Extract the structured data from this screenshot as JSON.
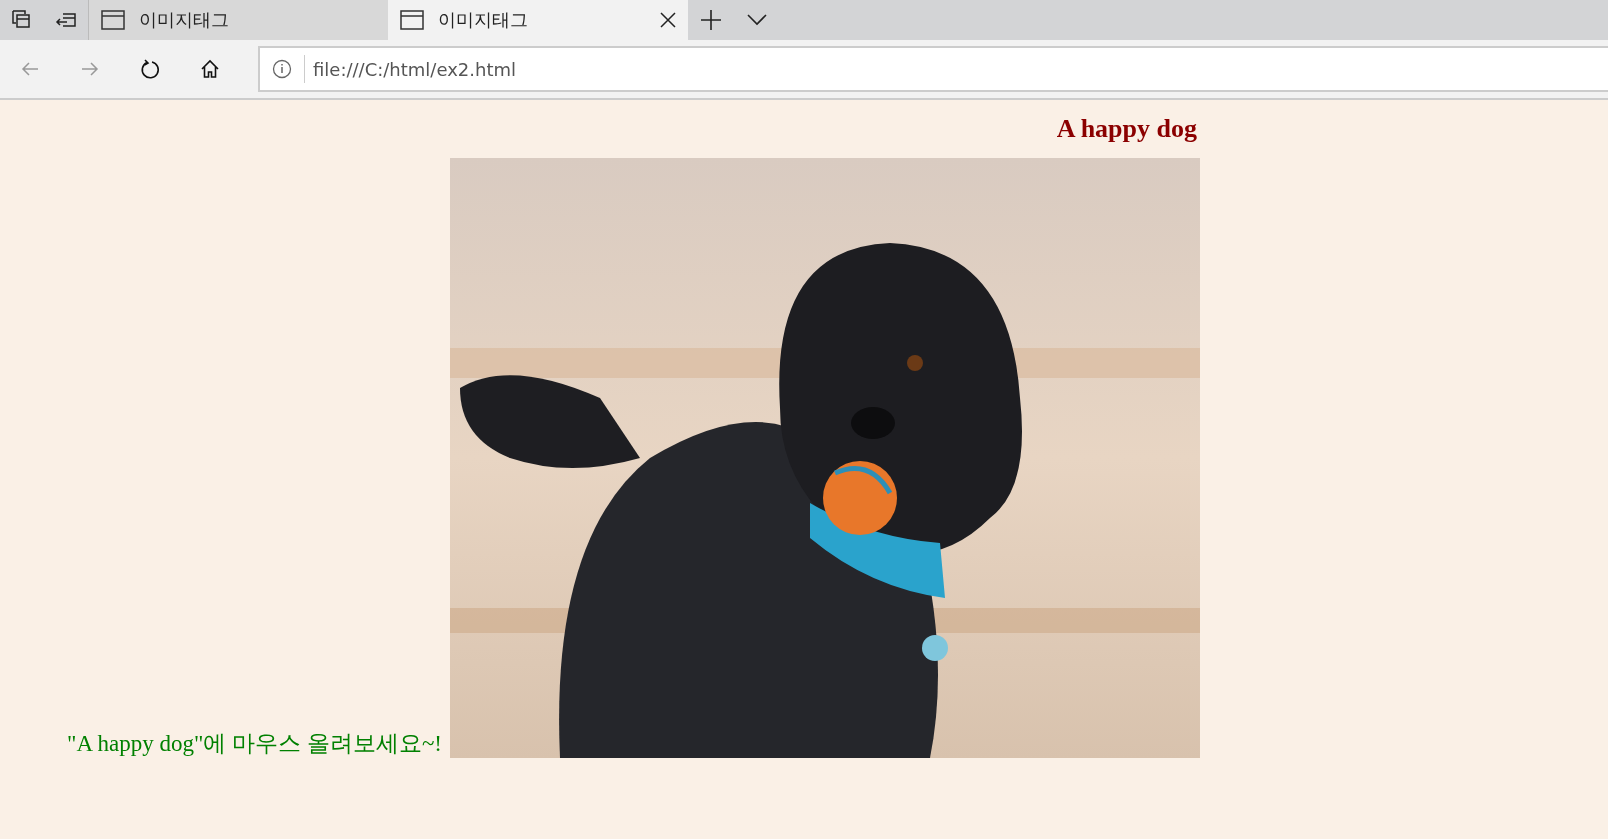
{
  "tabs": [
    {
      "title": "이미지태그",
      "selected": false
    },
    {
      "title": "이미지태그",
      "selected": true
    }
  ],
  "nav_buttons": [
    {
      "kind": "back",
      "disabled": true
    },
    {
      "kind": "forward",
      "disabled": true
    },
    {
      "kind": "refresh",
      "disabled": false
    },
    {
      "kind": "home",
      "disabled": false
    }
  ],
  "address_bar": {
    "value": "file:///C:/html/ex2.html"
  },
  "page": {
    "heading": "A happy dog",
    "caption": "\"A happy dog\"에 마우스 올려보세요~!"
  }
}
